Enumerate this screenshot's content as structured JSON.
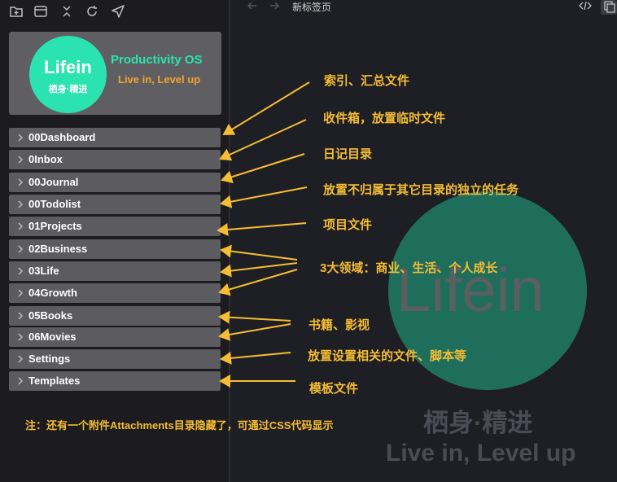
{
  "toolbar": {
    "icons": [
      "folder-add-icon",
      "window-icon",
      "collapse-icon",
      "refresh-icon",
      "send-icon"
    ]
  },
  "banner": {
    "logo_title": "Lifein",
    "logo_subtitle": "栖身·精进",
    "heading": "Productivity OS",
    "tagline": "Live in, Level up"
  },
  "folders": [
    "00Dashboard",
    "0Inbox",
    "00Journal",
    "00Todolist",
    "01Projects",
    "02Business",
    "03Life",
    "04Growth",
    "05Books",
    "06Movies",
    "Settings",
    "Templates"
  ],
  "tab": {
    "title": "新标签页"
  },
  "watermark": {
    "title": "Lifein",
    "subtitle": "栖身·精进",
    "tagline": "Live in, Level up"
  },
  "annotations": [
    "索引、汇总文件",
    "收件箱，放置临时文件",
    "日记目录",
    "放置不归属于其它目录的独立的任务",
    "项目文件",
    "3大领域：商业、生活、个人成长",
    "书籍、影视",
    "放置设置相关的文件、脚本等",
    "模板文件"
  ],
  "footnote": "注：还有一个附件Attachments目录隐藏了，可通过CSS代码显示",
  "colors": {
    "accent": "#2be3b0",
    "annotation": "#f5bd34",
    "tagline": "#f3a32a"
  }
}
